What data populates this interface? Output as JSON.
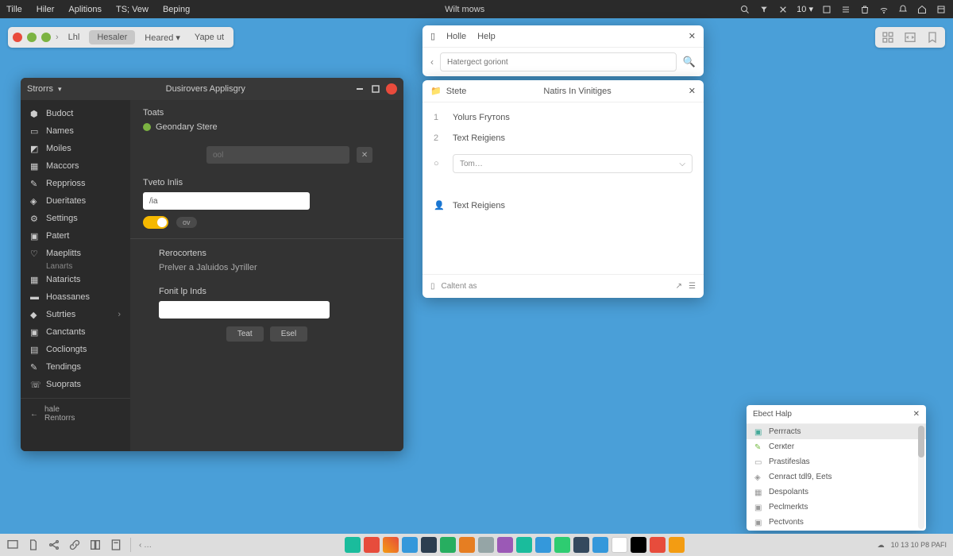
{
  "menubar": {
    "items": [
      "Tille",
      "Hiler",
      "Aplitions",
      "TS; Vew",
      "Beping"
    ],
    "title": "Wilt mows",
    "zoom": "10"
  },
  "toolbar2": {
    "label_lhl": "Lhl",
    "pill": "Hesaler",
    "text1": "Heared",
    "text2": "Yape ut"
  },
  "darkwin": {
    "titlebar_left": "Strorrs",
    "title": "Dusirovers Applisgry",
    "sidebar": [
      {
        "label": "Budoct"
      },
      {
        "label": "Names"
      },
      {
        "label": "Moiles"
      },
      {
        "label": "Maccors"
      },
      {
        "label": "Repprioss"
      },
      {
        "label": "Dueritates"
      },
      {
        "label": "Settings"
      },
      {
        "label": "Patert"
      },
      {
        "label": "Maeplitts",
        "sub": "Lanarts"
      },
      {
        "label": "Nataricts"
      },
      {
        "label": "Hoassanes"
      },
      {
        "label": "Sutrties",
        "chev": true
      },
      {
        "label": "Canctants"
      },
      {
        "label": "Cocliongts"
      },
      {
        "label": "Tendings"
      },
      {
        "label": "Suoprats"
      }
    ],
    "back": {
      "l1": "hale",
      "l2": "Rentorrs"
    },
    "content": {
      "section1": "Toats",
      "pill_label": "Geondary Stere",
      "input1_ph": "ool",
      "section2": "Tveto Inlis",
      "input2_val": "/ia",
      "toggle_label": "ov",
      "section3": "Rerocortens",
      "section3_sub": "Prelver a Jaluidos Jутiller",
      "section4": "Fonit lp Inds",
      "btn_text": "Teat",
      "btn_eset": "Esel"
    }
  },
  "homewin": {
    "tab1": "Holle",
    "tab2": "Help",
    "search_ph": "Hatergect goriont"
  },
  "noteswin": {
    "tab": "Stete",
    "title": "Natirs In Vinitiges",
    "rows": [
      {
        "n": "1",
        "label": "Yolurs Frутons"
      },
      {
        "n": "2",
        "label": "Text Reigiens"
      },
      {
        "n": "○",
        "label": "",
        "select": "Tom…"
      },
      {
        "n": "",
        "label": "Text Reigiens",
        "icon": true
      }
    ],
    "footer": "Caltent as"
  },
  "helpwin": {
    "title": "Ebect Halp",
    "items": [
      "Perrracts",
      "Cerкter",
      "Prastifeslas",
      "Cenract tdl9, Eets",
      "Despolants",
      "Peclmerkts",
      "Pectvonts"
    ]
  },
  "taskbar": {
    "pager": "‹ …",
    "clock": "10 13 10 P8 PAFI"
  }
}
